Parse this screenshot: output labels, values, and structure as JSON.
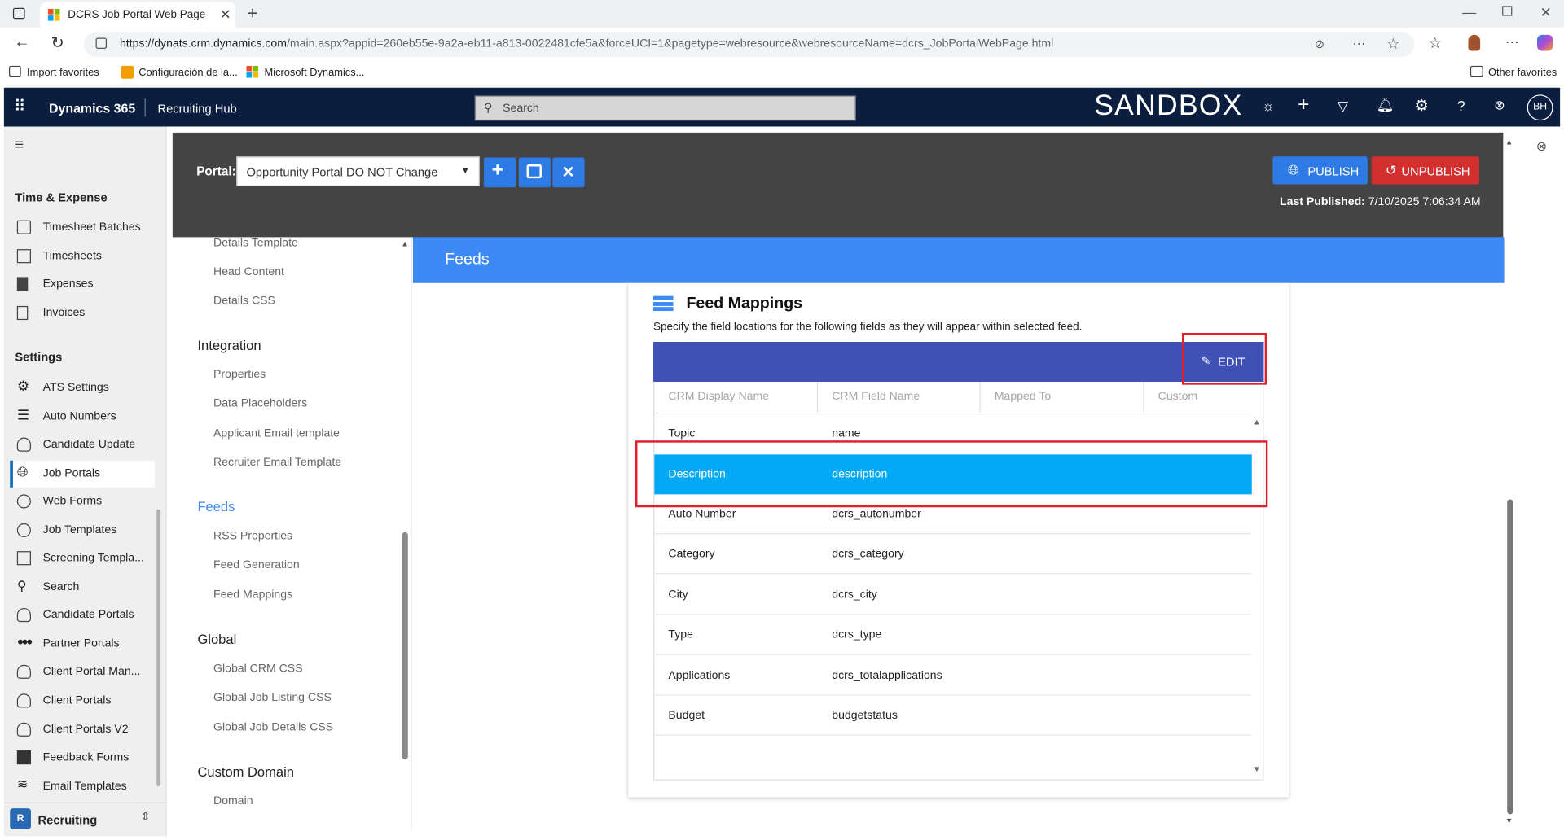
{
  "browser": {
    "tab_title": "DCRS Job Portal Web Page HTML",
    "url_host": "https://dynats.crm.dynamics.com",
    "url_rest": "/main.aspx?appid=260eb55e-9a2a-eb11-a813-0022481cfe5a&forceUCI=1&pagetype=webresource&webresourceName=dcrs_JobPortalWebPage.html",
    "favorites": [
      "Import favorites",
      "Configuración de la...",
      "Microsoft Dynamics..."
    ],
    "other_favorites": "Other favorites"
  },
  "header": {
    "app": "Dynamics 365",
    "module": "Recruiting Hub",
    "search_placeholder": "Search",
    "env": "SANDBOX",
    "avatar": "BH"
  },
  "nav": {
    "sections": [
      {
        "title": "Time & Expense",
        "items": [
          "Timesheet Batches",
          "Timesheets",
          "Expenses",
          "Invoices"
        ]
      },
      {
        "title": "Settings",
        "items": [
          "ATS Settings",
          "Auto Numbers",
          "Candidate Update",
          "Job Portals",
          "Web Forms",
          "Job Templates",
          "Screening Templa...",
          "Search",
          "Candidate Portals",
          "Partner Portals",
          "Client Portal Man...",
          "Client Portals",
          "Client Portals V2",
          "Feedback Forms",
          "Email Templates"
        ]
      }
    ],
    "selected": "Job Portals",
    "area_badge": "R",
    "area": "Recruiting"
  },
  "portal": {
    "label": "Portal:",
    "selected": "Opportunity Portal DO NOT Change",
    "publish": "PUBLISH",
    "unpublish": "UNPUBLISH",
    "last_published_label": "Last Published:",
    "last_published_value": "7/10/2025 7:06:34 AM"
  },
  "tree": {
    "top_items": [
      "Details Template",
      "Head Content",
      "Details CSS"
    ],
    "groups": [
      {
        "title": "Integration",
        "items": [
          "Properties",
          "Data Placeholders",
          "Applicant Email template",
          "Recruiter Email Template"
        ]
      },
      {
        "title": "Feeds",
        "items": [
          "RSS Properties",
          "Feed Generation",
          "Feed Mappings"
        ]
      },
      {
        "title": "Global",
        "items": [
          "Global CRM CSS",
          "Global Job Listing CSS",
          "Global Job Details CSS"
        ]
      },
      {
        "title": "Custom Domain",
        "items": [
          "Domain"
        ]
      }
    ]
  },
  "feeds": {
    "title": "Feeds",
    "card_title": "Feed Mappings",
    "card_desc": "Specify the field locations for the following fields as they will appear within selected feed.",
    "edit": "EDIT",
    "columns": [
      "CRM Display Name",
      "CRM Field Name",
      "Mapped To",
      "Custom"
    ],
    "rows": [
      [
        "Topic",
        "name"
      ],
      [
        "Description",
        "description"
      ],
      [
        "Auto Number",
        "dcrs_autonumber"
      ],
      [
        "Category",
        "dcrs_category"
      ],
      [
        "City",
        "dcrs_city"
      ],
      [
        "Type",
        "dcrs_type"
      ],
      [
        "Applications",
        "dcrs_totalapplications"
      ],
      [
        "Budget",
        "budgetstatus"
      ]
    ],
    "selected_row": "Description"
  },
  "colors": {
    "header": "#0b1e3f",
    "feeds_bar": "#3d8af7",
    "selected_row": "#03a9f4",
    "table_header": "#3f51b5",
    "publish": "#2f7be5",
    "unpublish": "#d32f2f",
    "highlight_box": "#e0202a"
  }
}
